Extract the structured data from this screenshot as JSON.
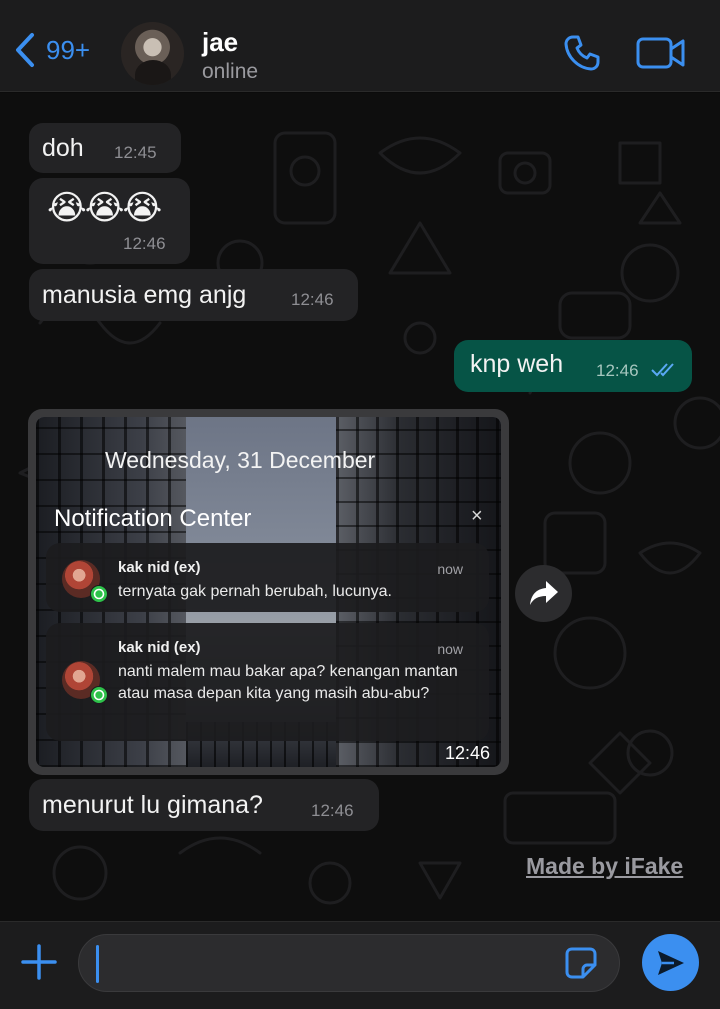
{
  "header": {
    "back_count": "99+",
    "contact_name": "jae",
    "contact_status": "online"
  },
  "messages": [
    {
      "direction": "in",
      "text": "doh",
      "time": "12:45"
    },
    {
      "direction": "in",
      "text": "😭😭😭",
      "time": "12:46"
    },
    {
      "direction": "in",
      "text": "manusia emg anjg",
      "time": "12:46"
    },
    {
      "direction": "out",
      "text": "knp weh",
      "time": "12:46",
      "status": "read"
    },
    {
      "direction": "in",
      "type": "image",
      "time": "12:46"
    },
    {
      "direction": "in",
      "text": "menurut lu gimana?",
      "time": "12:46"
    }
  ],
  "screenshot": {
    "date": "Wednesday, 31 December",
    "center_title": "Notification Center",
    "close": "×",
    "notifications": [
      {
        "sender": "kak nid (ex)",
        "when": "now",
        "body": "ternyata gak pernah berubah, lucunya."
      },
      {
        "sender": "kak nid (ex)",
        "when": "now",
        "body": "nanti malem mau bakar apa? kenangan mantan atau masa depan kita yang masih abu-abu?"
      }
    ]
  },
  "watermark": "Made by iFake",
  "composer": {
    "placeholder": ""
  },
  "colors": {
    "accent": "#3b8ff0",
    "incoming_bubble": "#232325",
    "outgoing_bubble": "#065446",
    "background": "#0e0e0e"
  },
  "icons": [
    "chevron-left-icon",
    "phone-icon",
    "video-camera-icon",
    "forward-icon",
    "plus-icon",
    "sticker-icon",
    "send-icon",
    "double-check-icon",
    "whatsapp-icon"
  ]
}
